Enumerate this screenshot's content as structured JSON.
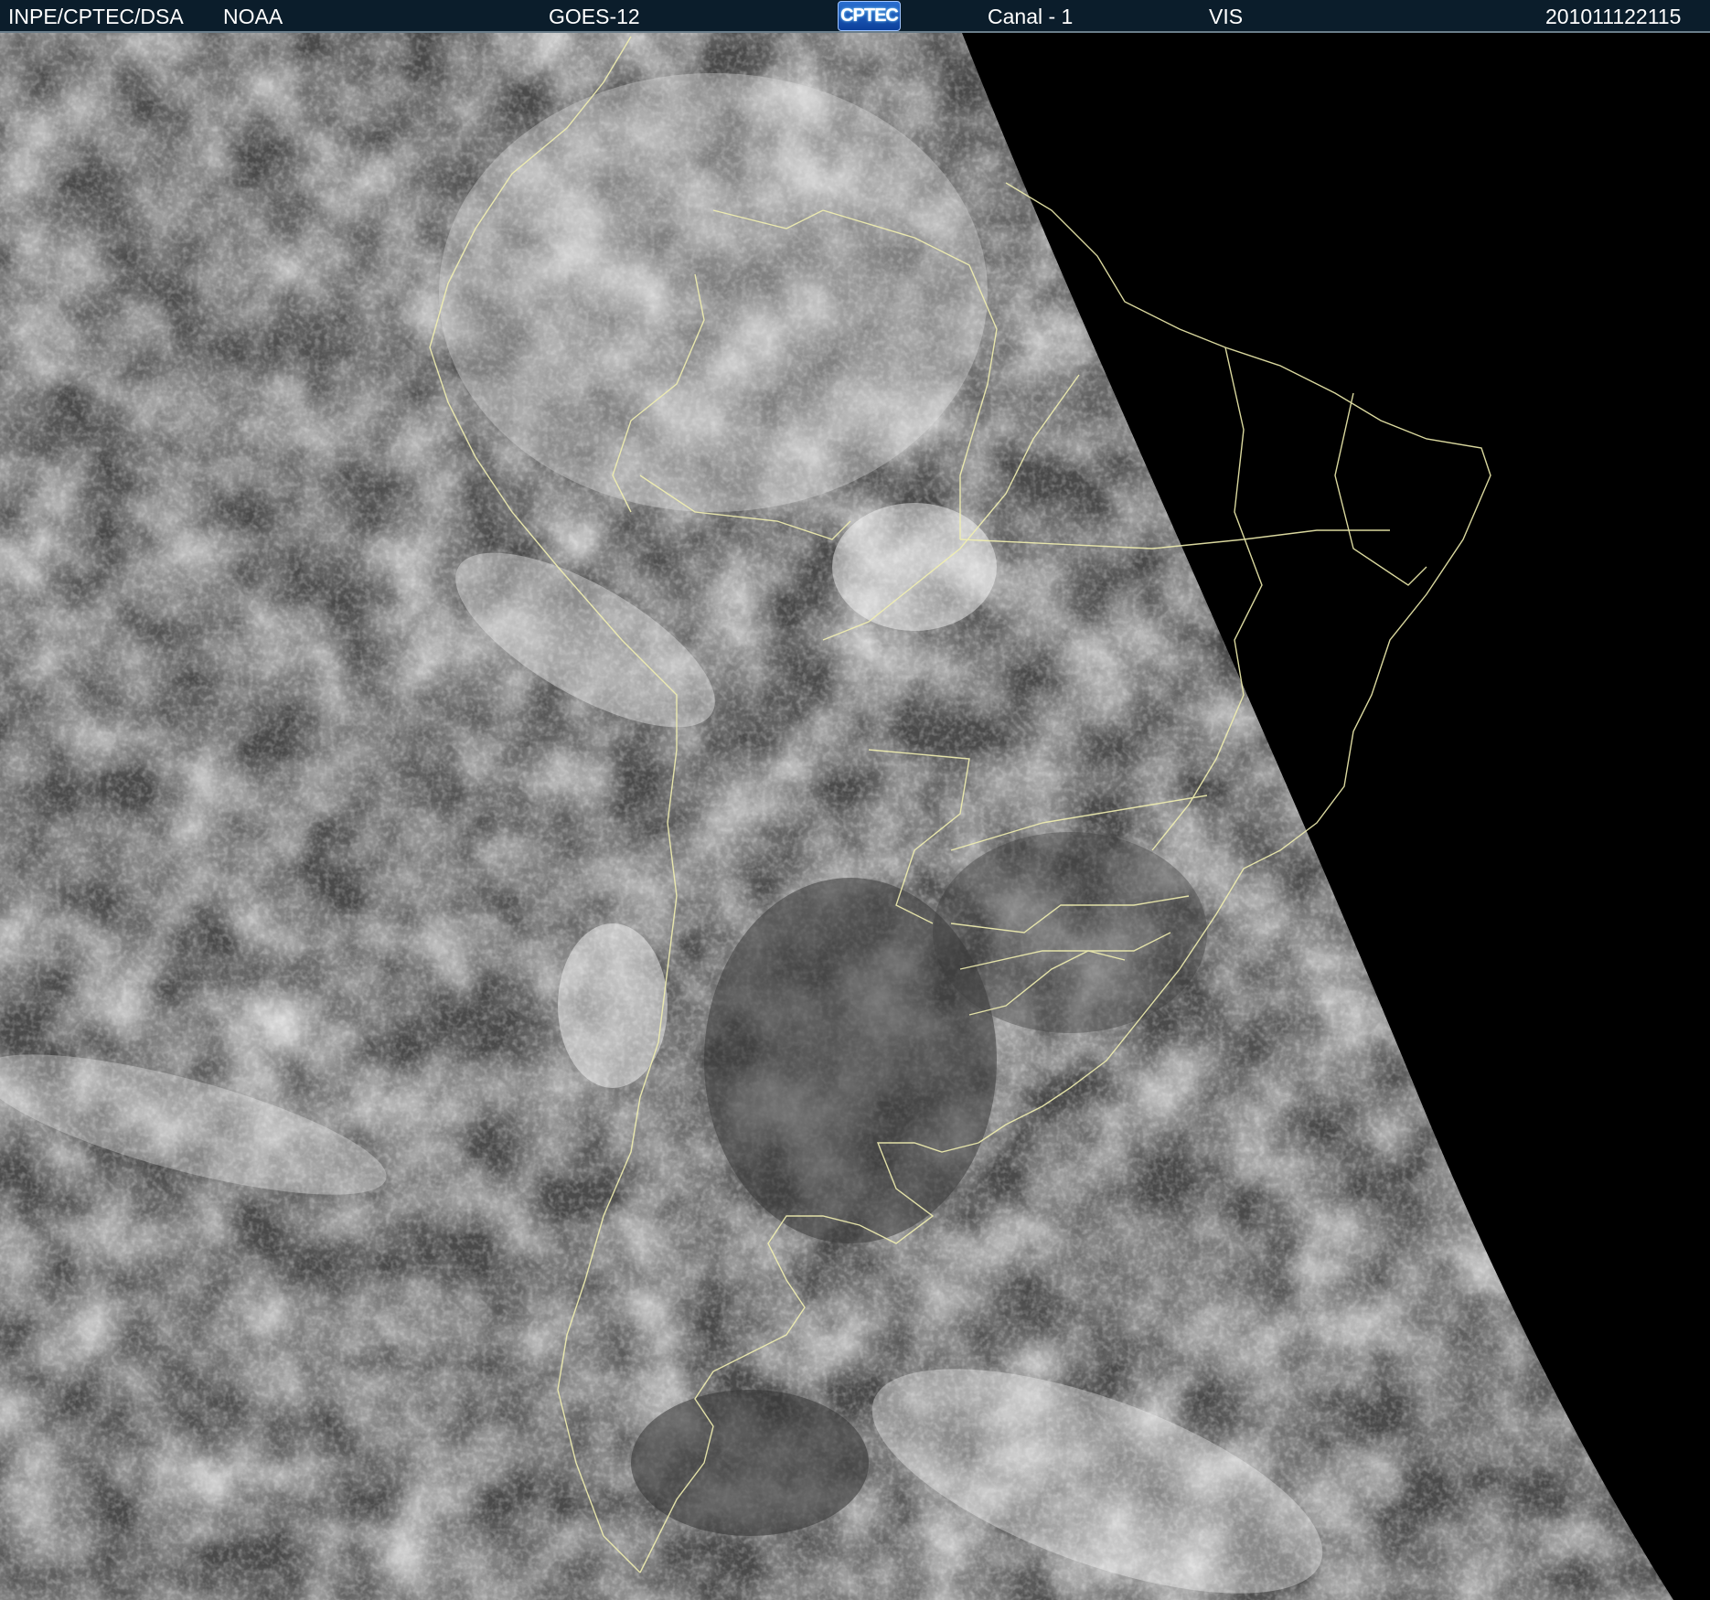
{
  "header": {
    "org": "INPE/CPTEC/DSA",
    "agency": "NOAA",
    "satellite": "GOES-12",
    "logo_text": "CPTEC",
    "channel": "Canal - 1",
    "band": "VIS",
    "timestamp": "201011122115"
  },
  "colors": {
    "header_bg": "#0b1d2b",
    "header_text": "#ffffff",
    "space": "#000000",
    "boundary_line": "#f2f0b0"
  },
  "icons": {
    "logo": "cptec-logo"
  }
}
